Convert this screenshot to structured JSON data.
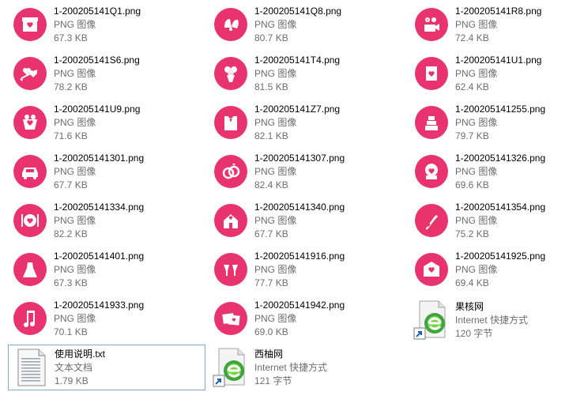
{
  "colors": {
    "icon_pink": "#e8336f",
    "icon_white": "#ffffff",
    "selection_border": "#7fa9d6"
  },
  "files": [
    {
      "name": "1-200205141Q1.png",
      "type": "PNG 图像",
      "size": "67.3 KB",
      "icon": "gift-box-icon",
      "kind": "png"
    },
    {
      "name": "1-200205141Q8.png",
      "type": "PNG 图像",
      "size": "80.7 KB",
      "icon": "wedding-bells-icon",
      "kind": "png"
    },
    {
      "name": "1-200205141R8.png",
      "type": "PNG 图像",
      "size": "72.4 KB",
      "icon": "video-camera-hearts-icon",
      "kind": "png"
    },
    {
      "name": "1-200205141S6.png",
      "type": "PNG 图像",
      "size": "78.2 KB",
      "icon": "cupid-arrow-icon",
      "kind": "png"
    },
    {
      "name": "1-200205141T4.png",
      "type": "PNG 图像",
      "size": "81.5 KB",
      "icon": "flower-bouquet-icon",
      "kind": "png"
    },
    {
      "name": "1-200205141U1.png",
      "type": "PNG 图像",
      "size": "62.4 KB",
      "icon": "love-card-icon",
      "kind": "png"
    },
    {
      "name": "1-200205141U9.png",
      "type": "PNG 图像",
      "size": "71.6 KB",
      "icon": "heart-basket-icon",
      "kind": "png"
    },
    {
      "name": "1-200205141Z7.png",
      "type": "PNG 图像",
      "size": "82.1 KB",
      "icon": "tuxedo-icon",
      "kind": "png"
    },
    {
      "name": "1-200205141255.png",
      "type": "PNG 图像",
      "size": "79.7 KB",
      "icon": "wedding-cake-icon",
      "kind": "png"
    },
    {
      "name": "1-200205141301.png",
      "type": "PNG 图像",
      "size": "67.7 KB",
      "icon": "wedding-car-icon",
      "kind": "png"
    },
    {
      "name": "1-200205141307.png",
      "type": "PNG 图像",
      "size": "82.4 KB",
      "icon": "wedding-rings-icon",
      "kind": "png"
    },
    {
      "name": "1-200205141326.png",
      "type": "PNG 图像",
      "size": "69.6 KB",
      "icon": "snow-globe-icon",
      "kind": "png"
    },
    {
      "name": "1-200205141334.png",
      "type": "PNG 图像",
      "size": "82.2 KB",
      "icon": "dinner-plate-icon",
      "kind": "png"
    },
    {
      "name": "1-200205141340.png",
      "type": "PNG 图像",
      "size": "67.7 KB",
      "icon": "chapel-icon",
      "kind": "png"
    },
    {
      "name": "1-200205141354.png",
      "type": "PNG 图像",
      "size": "75.2 KB",
      "icon": "champagne-bottle-icon",
      "kind": "png"
    },
    {
      "name": "1-200205141401.png",
      "type": "PNG 图像",
      "size": "67.3 KB",
      "icon": "wedding-dress-icon",
      "kind": "png"
    },
    {
      "name": "1-200205141916.png",
      "type": "PNG 图像",
      "size": "77.7 KB",
      "icon": "champagne-glasses-icon",
      "kind": "png"
    },
    {
      "name": "1-200205141925.png",
      "type": "PNG 图像",
      "size": "69.4 KB",
      "icon": "love-envelope-icon",
      "kind": "png"
    },
    {
      "name": "1-200205141933.png",
      "type": "PNG 图像",
      "size": "70.1 KB",
      "icon": "music-note-icon",
      "kind": "png"
    },
    {
      "name": "1-200205141942.png",
      "type": "PNG 图像",
      "size": "69.0 KB",
      "icon": "photo-frames-icon",
      "kind": "png"
    },
    {
      "name": "果核网",
      "type": "Internet 快捷方式",
      "size": "120 字节",
      "icon": "internet-shortcut-icon",
      "kind": "url"
    },
    {
      "name": "使用说明.txt",
      "type": "文本文档",
      "size": "1.79 KB",
      "icon": "text-document-icon",
      "kind": "txt",
      "selected": true
    },
    {
      "name": "西柚网",
      "type": "Internet 快捷方式",
      "size": "121 字节",
      "icon": "internet-shortcut-icon",
      "kind": "url"
    }
  ]
}
